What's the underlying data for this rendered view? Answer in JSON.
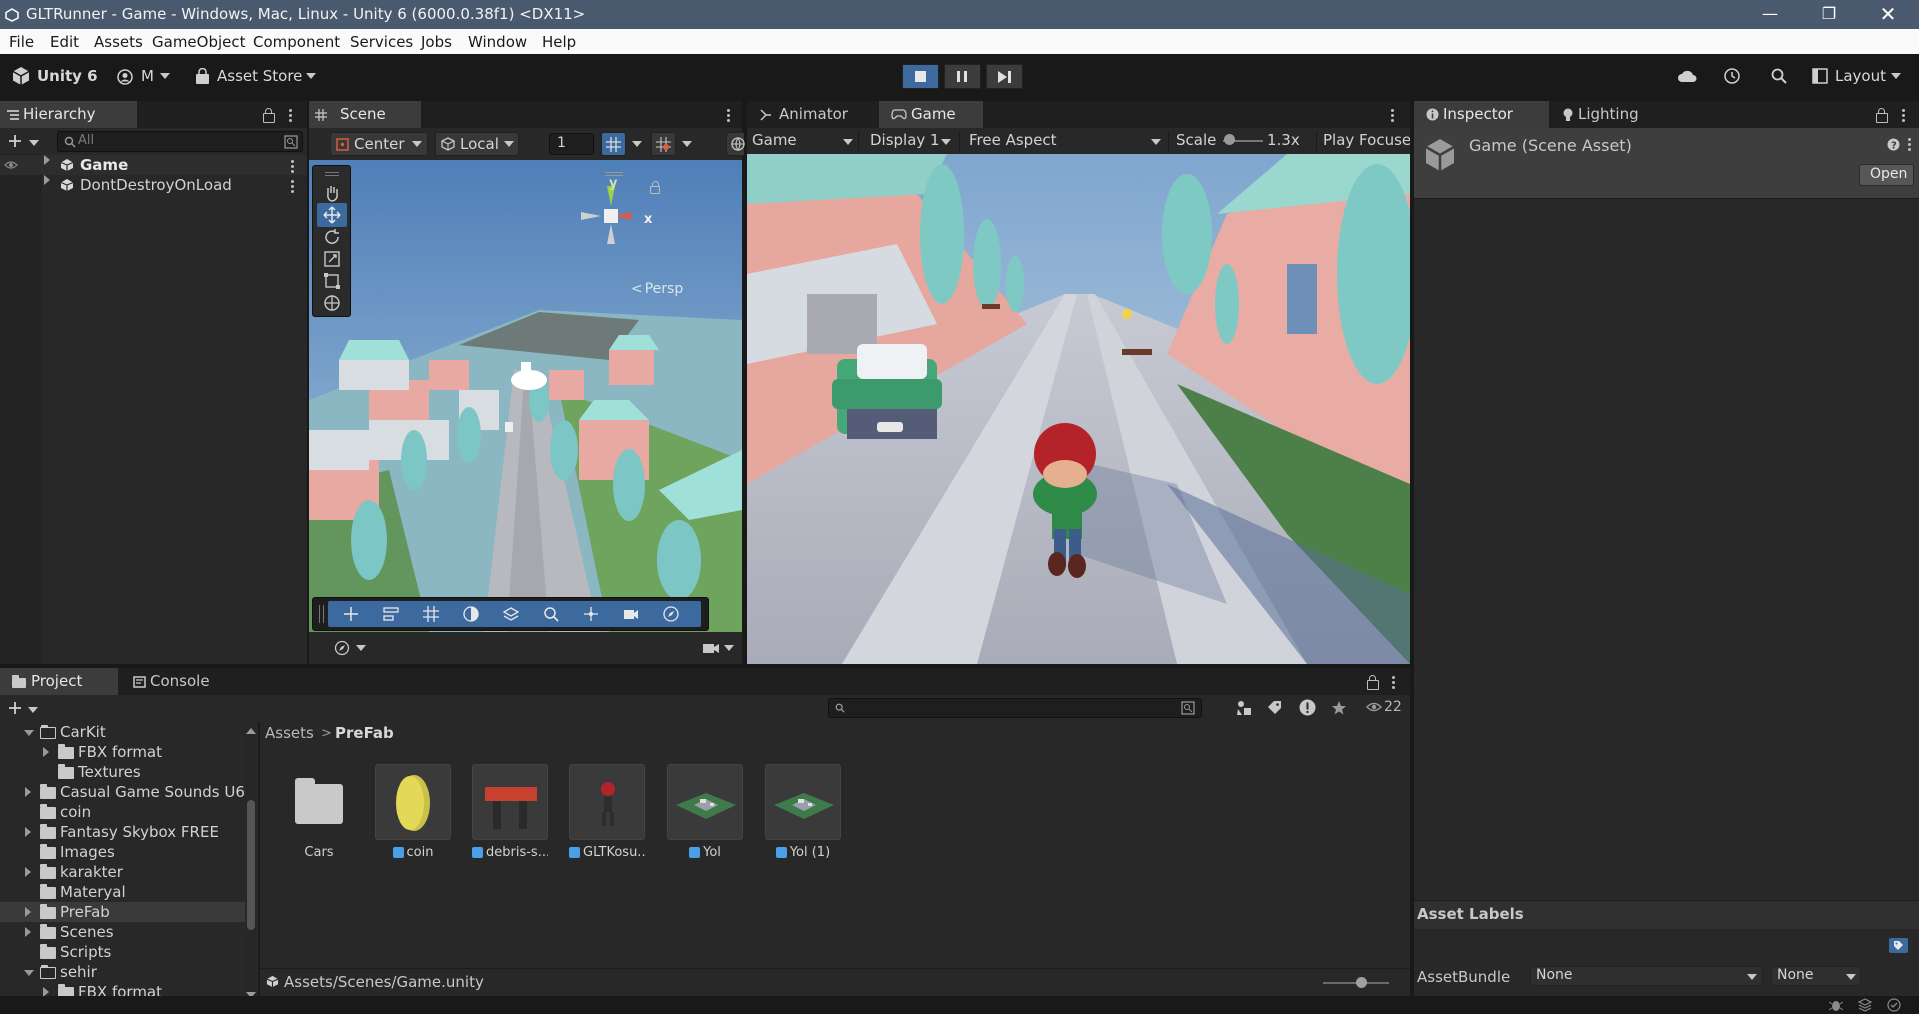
{
  "window": {
    "title": "GLTRunner - Game - Windows, Mac, Linux - Unity 6 (6000.0.38f1) <DX11>"
  },
  "menu": [
    "File",
    "Edit",
    "Assets",
    "GameObject",
    "Component",
    "Services",
    "Jobs",
    "Window",
    "Help"
  ],
  "toolbar": {
    "unity_label": "Unity 6",
    "account_label": "M",
    "asset_store_label": "Asset Store",
    "layout_label": "Layout"
  },
  "hierarchy": {
    "tab_label": "Hierarchy",
    "search_placeholder": "All",
    "items": [
      "Game",
      "DontDestroyOnLoad"
    ]
  },
  "scene": {
    "tab_label": "Scene",
    "pivot_label": "Center",
    "space_label": "Local",
    "grid_value": "1",
    "gizmo_y": "y",
    "gizmo_x": "x",
    "persp_label": "Persp"
  },
  "animator": {
    "tab_label": "Animator"
  },
  "game": {
    "tab_label": "Game",
    "display_mode": "Game",
    "display": "Display 1",
    "aspect": "Free Aspect",
    "scale_label": "Scale",
    "scale_value": "1.3x",
    "play_focused": "Play Focused"
  },
  "inspector": {
    "tab_label": "Inspector",
    "lighting_tab": "Lighting",
    "asset_title": "Game (Scene Asset)",
    "open_button": "Open",
    "asset_labels": "Asset Labels",
    "assetbundle_label": "AssetBundle",
    "assetbundle_value": "None",
    "variant_value": "None"
  },
  "project": {
    "tab_label": "Project",
    "console_tab": "Console",
    "hidden_count": "22",
    "breadcrumb": [
      "Assets",
      "PreFab"
    ],
    "tree": [
      {
        "label": "CarKit",
        "level": 1,
        "expanded": true,
        "open": true
      },
      {
        "label": "FBX format",
        "level": 2,
        "arrow": true
      },
      {
        "label": "Textures",
        "level": 2,
        "arrow": false
      },
      {
        "label": "Casual Game Sounds U6",
        "level": 1,
        "arrow": true
      },
      {
        "label": "coin",
        "level": 1,
        "arrow": false
      },
      {
        "label": "Fantasy Skybox FREE",
        "level": 1,
        "arrow": true
      },
      {
        "label": "Images",
        "level": 1,
        "arrow": false
      },
      {
        "label": "karakter",
        "level": 1,
        "arrow": true
      },
      {
        "label": "Materyal",
        "level": 1,
        "arrow": false
      },
      {
        "label": "PreFab",
        "level": 1,
        "arrow": true,
        "selected": true
      },
      {
        "label": "Scenes",
        "level": 1,
        "arrow": true
      },
      {
        "label": "Scripts",
        "level": 1,
        "arrow": false
      },
      {
        "label": "sehir",
        "level": 1,
        "expanded": true,
        "open": true
      },
      {
        "label": "FBX format",
        "level": 2,
        "arrow": true
      }
    ],
    "assets": [
      {
        "label": "Cars",
        "kind": "folder"
      },
      {
        "label": "coin",
        "kind": "coin"
      },
      {
        "label": "debris-s...",
        "kind": "debris"
      },
      {
        "label": "GLTKosu...",
        "kind": "character"
      },
      {
        "label": "Yol",
        "kind": "road"
      },
      {
        "label": "Yol (1)",
        "kind": "road"
      }
    ],
    "status_path": "Assets/Scenes/Game.unity"
  },
  "colors": {
    "title_bar": "#4a5a6e",
    "panel_bg": "#282828",
    "active_tab": "#3c3c3c",
    "selection": "#3a3a3a",
    "accent_blue": "#3d6a9e"
  }
}
